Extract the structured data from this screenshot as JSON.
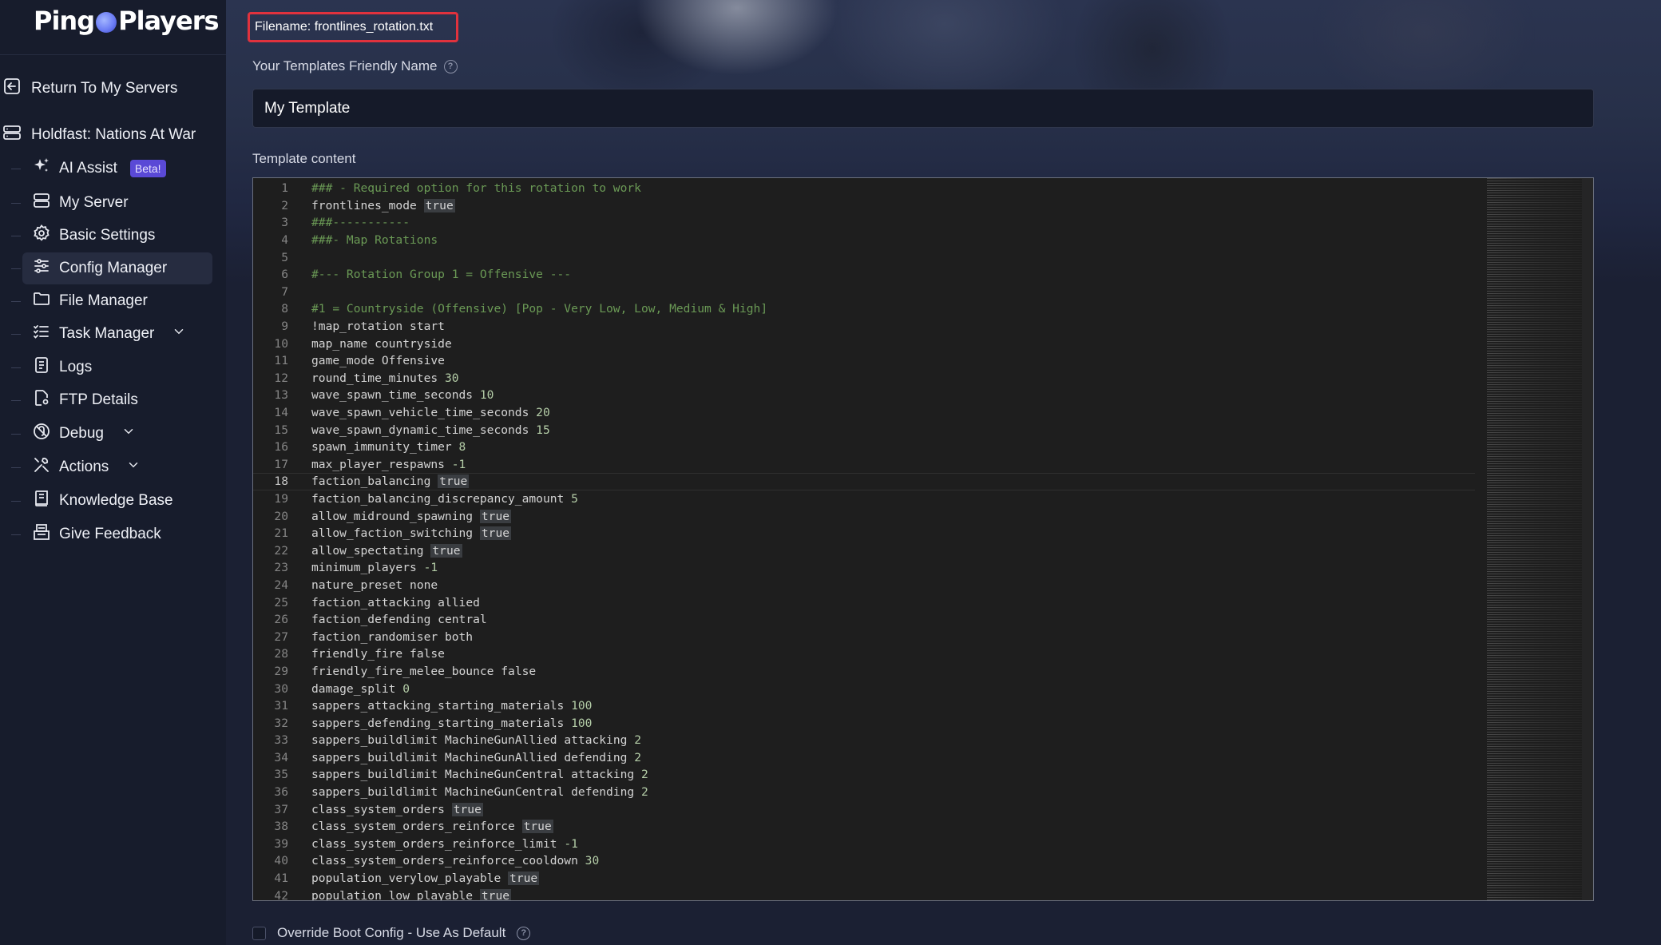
{
  "brand": {
    "logo_text_left": "Ping",
    "logo_text_right": "Players"
  },
  "sidebar": {
    "return_label": "Return To My Servers",
    "server_label": "Holdfast: Nations At War",
    "items": [
      {
        "label": "AI Assist",
        "icon": "sparkle-icon",
        "badge": "Beta!"
      },
      {
        "label": "My Server",
        "icon": "server-icon"
      },
      {
        "label": "Basic Settings",
        "icon": "gear-icon"
      },
      {
        "label": "Config Manager",
        "icon": "sliders-icon",
        "active": true
      },
      {
        "label": "File Manager",
        "icon": "folder-icon"
      },
      {
        "label": "Task Manager",
        "icon": "tasklist-icon",
        "expandable": true
      },
      {
        "label": "Logs",
        "icon": "document-icon"
      },
      {
        "label": "FTP Details",
        "icon": "file-settings-icon"
      },
      {
        "label": "Debug",
        "icon": "bug-off-icon",
        "expandable": true
      },
      {
        "label": "Actions",
        "icon": "tools-icon",
        "expandable": true
      },
      {
        "label": "Knowledge Base",
        "icon": "book-icon"
      },
      {
        "label": "Give Feedback",
        "icon": "feedback-icon"
      }
    ]
  },
  "form": {
    "filename": "Filename: frontlines_rotation.txt",
    "friendly_name_label": "Your Templates Friendly Name",
    "friendly_name_value": "My Template",
    "template_content_label": "Template content",
    "override_label": "Override Boot Config - Use As Default"
  },
  "editor": {
    "current_line": 18,
    "lines": [
      "### - Required option for this rotation to work",
      "frontlines_mode true",
      "###-----------",
      "###- Map Rotations",
      "",
      "#--- Rotation Group 1 = Offensive ---",
      "",
      "#1 = Countryside (Offensive) [Pop - Very Low, Low, Medium & High]",
      "!map_rotation start",
      "map_name countryside",
      "game_mode Offensive",
      "round_time_minutes 30",
      "wave_spawn_time_seconds 10",
      "wave_spawn_vehicle_time_seconds 20",
      "wave_spawn_dynamic_time_seconds 15",
      "spawn_immunity_timer 8",
      "max_player_respawns -1",
      "faction_balancing true",
      "faction_balancing_discrepancy_amount 5",
      "allow_midround_spawning true",
      "allow_faction_switching true",
      "allow_spectating true",
      "minimum_players -1",
      "nature_preset none",
      "faction_attacking allied",
      "faction_defending central",
      "faction_randomiser both",
      "friendly_fire false",
      "friendly_fire_melee_bounce false",
      "damage_split 0",
      "sappers_attacking_starting_materials 100",
      "sappers_defending_starting_materials 100",
      "sappers_buildlimit MachineGunAllied attacking 2",
      "sappers_buildlimit MachineGunAllied defending 2",
      "sappers_buildlimit MachineGunCentral attacking 2",
      "sappers_buildlimit MachineGunCentral defending 2",
      "class_system_orders true",
      "class_system_orders_reinforce true",
      "class_system_orders_reinforce_limit -1",
      "class_system_orders_reinforce_cooldown 30",
      "population_verylow_playable true",
      "population_low_playable true"
    ]
  },
  "colors": {
    "accent_badge": "#5a49d6",
    "highlight_border": "#e0323d",
    "comment": "#6a9955",
    "number": "#b5cea8"
  }
}
